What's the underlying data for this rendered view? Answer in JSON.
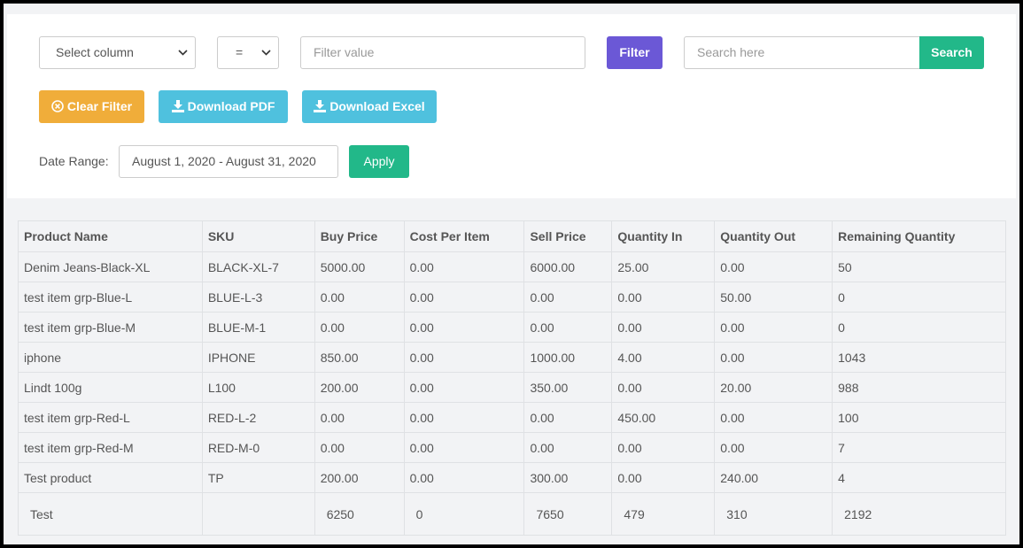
{
  "filters": {
    "column_select": "Select column",
    "operator_select": "=",
    "filter_value_placeholder": "Filter value",
    "filter_button": "Filter",
    "search_placeholder": "Search here",
    "search_button": "Search"
  },
  "actions": {
    "clear_filter": "Clear Filter",
    "download_pdf": "Download PDF",
    "download_excel": "Download Excel"
  },
  "date_range": {
    "label": "Date Range:",
    "value": "August 1, 2020 - August 31, 2020",
    "apply_button": "Apply"
  },
  "colors": {
    "filter": "#6b58d6",
    "search": "#22b889",
    "clear": "#f0ad3a",
    "download": "#4fc1de"
  },
  "table": {
    "columns": [
      "Product Name",
      "SKU",
      "Buy Price",
      "Cost Per Item",
      "Sell Price",
      "Quantity In",
      "Quantity Out",
      "Remaining Quantity"
    ],
    "rows": [
      [
        "Denim Jeans-Black-XL",
        "BLACK-XL-7",
        "5000.00",
        "0.00",
        "6000.00",
        "25.00",
        "0.00",
        "50"
      ],
      [
        "test item grp-Blue-L",
        "BLUE-L-3",
        "0.00",
        "0.00",
        "0.00",
        "0.00",
        "50.00",
        "0"
      ],
      [
        "test item grp-Blue-M",
        "BLUE-M-1",
        "0.00",
        "0.00",
        "0.00",
        "0.00",
        "0.00",
        "0"
      ],
      [
        "iphone",
        "IPHONE",
        "850.00",
        "0.00",
        "1000.00",
        "4.00",
        "0.00",
        "1043"
      ],
      [
        "Lindt 100g",
        "L100",
        "200.00",
        "0.00",
        "350.00",
        "0.00",
        "20.00",
        "988"
      ],
      [
        "test item grp-Red-L",
        "RED-L-2",
        "0.00",
        "0.00",
        "0.00",
        "450.00",
        "0.00",
        "100"
      ],
      [
        "test item grp-Red-M",
        "RED-M-0",
        "0.00",
        "0.00",
        "0.00",
        "0.00",
        "0.00",
        "7"
      ],
      [
        "Test product",
        "TP",
        "200.00",
        "0.00",
        "300.00",
        "0.00",
        "240.00",
        "4"
      ]
    ],
    "total": [
      "Test",
      "",
      "6250",
      "0",
      "7650",
      "479",
      "310",
      "2192"
    ]
  }
}
